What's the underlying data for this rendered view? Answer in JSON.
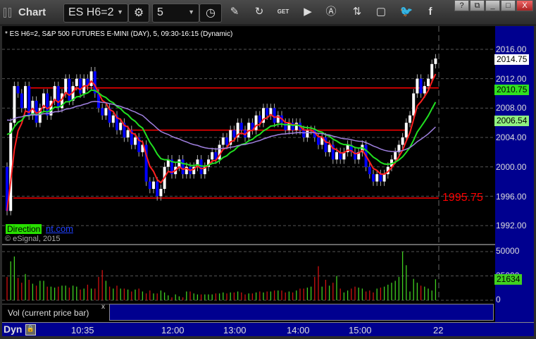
{
  "window": {
    "title": "Chart",
    "symbol": "ES H6=2",
    "interval": "5",
    "buttons": [
      "?",
      "restore",
      "_",
      "□",
      "X"
    ]
  },
  "toolbar_icons": [
    "settings-icon",
    "clock-icon",
    "pencil-icon",
    "refresh-icon",
    "get-icon",
    "play-icon",
    "a-icon",
    "link-icon",
    "comment-icon",
    "twitter-icon",
    "facebook-icon"
  ],
  "chart": {
    "header": "* ES H6=2, S&P 500 FUTURES E-MINI (DAY), 5, 09:30-16:15 (Dynamic)",
    "price_labels": [
      "2016.00",
      "2012.00",
      "2008.00",
      "2004.00",
      "2000.00",
      "1996.00",
      "1992.00"
    ],
    "tags": {
      "last": "2014.75",
      "level": "2010.75",
      "ma": "2006.54"
    },
    "level_label": "1995.75",
    "levels": [
      2010.75,
      2005,
      1995.75
    ],
    "direction_label": "Direction",
    "direction_link": "nt.com",
    "copyright": "© eSignal, 2015",
    "volume_labels": [
      "50000",
      "25000",
      "0"
    ],
    "volume_tag": "21634",
    "study_label": "Vol (current price bar)",
    "study_close": "x",
    "time_labels": [
      "10:35",
      "12:00",
      "13:00",
      "14:00",
      "15:00",
      "22"
    ],
    "dyn_label": "Dyn",
    "colors": {
      "up": "#ffffff",
      "down": "#0000ff",
      "fast": "#ff2020",
      "mid": "#20e020",
      "slow": "#a080e0",
      "volUp": "#40d020",
      "volDown": "#d01010"
    },
    "closes": [
      1994,
      2006,
      2011,
      2010,
      2008,
      2011,
      2007,
      2009,
      2006,
      2008,
      2010,
      2007,
      2009,
      2011,
      2008,
      2010,
      2012,
      2009,
      2011,
      2012,
      2010,
      2012,
      2011,
      2013,
      2010,
      2008,
      2007,
      2008,
      2006,
      2007,
      2005,
      2006,
      2004,
      2005,
      2003,
      2004,
      2002,
      2003,
      1998,
      1997,
      1998,
      1996,
      1997,
      2000,
      2001,
      1999,
      2000,
      2001,
      1999,
      2000,
      1999,
      2000,
      2001,
      1999,
      2000,
      2001,
      2002,
      2001,
      2003,
      2004,
      2003,
      2005,
      2004,
      2006,
      2005,
      2004,
      2006,
      2005,
      2007,
      2006,
      2008,
      2007,
      2008,
      2006,
      2007,
      2006,
      2005,
      2006,
      2005,
      2006,
      2005,
      2004,
      2005,
      2005,
      2004,
      2003,
      2004,
      2002,
      2003,
      2001,
      2002,
      2001,
      2002,
      2003,
      2002,
      2001,
      2002,
      2003,
      2000,
      1999,
      1998,
      1999,
      1998,
      1999,
      2000,
      2001,
      2002,
      2003,
      2004,
      2006,
      2007,
      2010,
      2012,
      2010,
      2011,
      2012,
      2014,
      2014.75
    ],
    "volume_k": [
      24,
      40,
      45,
      23,
      18,
      27,
      21,
      17,
      15,
      20,
      20,
      14,
      14,
      13,
      14,
      15,
      15,
      13,
      15,
      14,
      11,
      12,
      16,
      12,
      12,
      24,
      31,
      20,
      14,
      12,
      15,
      12,
      12,
      11,
      9,
      11,
      12,
      9,
      7,
      10,
      7,
      7,
      10,
      8,
      5,
      3,
      6,
      4,
      3,
      9,
      9,
      7,
      6,
      6,
      6,
      6,
      6,
      7,
      7,
      8,
      7,
      8,
      8,
      9,
      8,
      6,
      7,
      7,
      8,
      9,
      8,
      9,
      9,
      10,
      10,
      10,
      8,
      9,
      8,
      10,
      12,
      12,
      13,
      14,
      24,
      35,
      14,
      21,
      15,
      18,
      25,
      12,
      8,
      10,
      12,
      14,
      13,
      12,
      9,
      10,
      8,
      12,
      13,
      14,
      16,
      18,
      20,
      24,
      50,
      36,
      9,
      22,
      18,
      15,
      14,
      12,
      10,
      21.6
    ]
  }
}
